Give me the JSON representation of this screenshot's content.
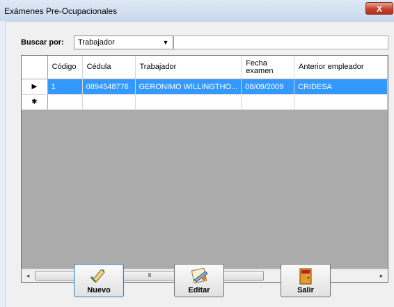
{
  "window": {
    "title": "Exámenes Pre-Ocupacionales",
    "close_glyph": "X"
  },
  "search": {
    "label": "Buscar por:",
    "field": "Trabajador",
    "value": ""
  },
  "grid": {
    "columns": [
      "Código",
      "Cédula",
      "Trabajador",
      "Fecha examen",
      "Anterior empleador"
    ],
    "rows": [
      {
        "indicator": "▶",
        "codigo": "1",
        "cedula": "0894548776",
        "trabajador": "GERONIMO WILLINGTHO...",
        "fecha": "08/09/2009",
        "empleador": "CRIDESA"
      }
    ],
    "new_row_indicator": "✱",
    "scrollbar": {
      "left": "◂",
      "right": "▸",
      "grip": "III"
    }
  },
  "buttons": {
    "nuevo": "Nuevo",
    "editar": "Editar",
    "salir": "Salir"
  },
  "icons": {
    "nuevo": "pencil-check-icon",
    "editar": "edit-document-icon",
    "salir": "exit-door-icon"
  },
  "colors": {
    "selection": "#3399ff",
    "grid_background": "#ababab"
  }
}
